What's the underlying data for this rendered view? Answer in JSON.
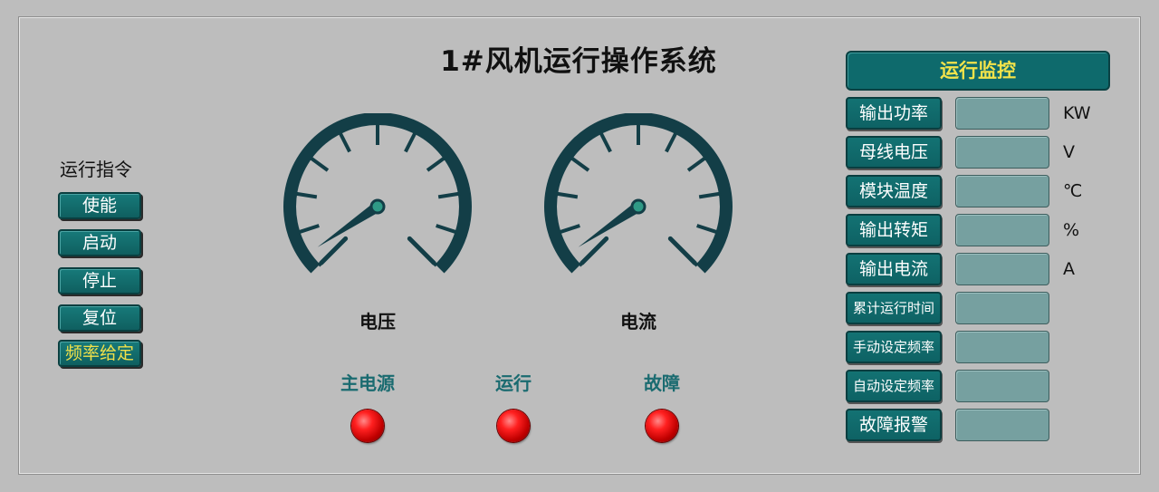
{
  "title": "1#风机运行操作系统",
  "commands": {
    "title": "运行指令",
    "buttons": [
      "使能",
      "启动",
      "停止",
      "复位",
      "频率给定"
    ]
  },
  "gauges": [
    {
      "label": "电压",
      "needle": "low"
    },
    {
      "label": "电流",
      "needle": "low"
    }
  ],
  "indicators": [
    "主电源",
    "运行",
    "故障"
  ],
  "monitor": {
    "header": "运行监控",
    "rows": [
      {
        "label": "输出功率",
        "unit": "KW"
      },
      {
        "label": "母线电压",
        "unit": "V"
      },
      {
        "label": "模块温度",
        "unit": "℃"
      },
      {
        "label": "输出转矩",
        "unit": "%"
      },
      {
        "label": "输出电流",
        "unit": "A"
      },
      {
        "label": "累计运行时间",
        "unit": ""
      },
      {
        "label": "手动设定频率",
        "unit": ""
      },
      {
        "label": "自动设定频率",
        "unit": ""
      },
      {
        "label": "故障报警",
        "unit": ""
      }
    ]
  },
  "colors": {
    "background": "#bdbdbd",
    "accent": "#0e6a6c",
    "header_text": "#f3e34a",
    "lamp": "#ff2020"
  }
}
